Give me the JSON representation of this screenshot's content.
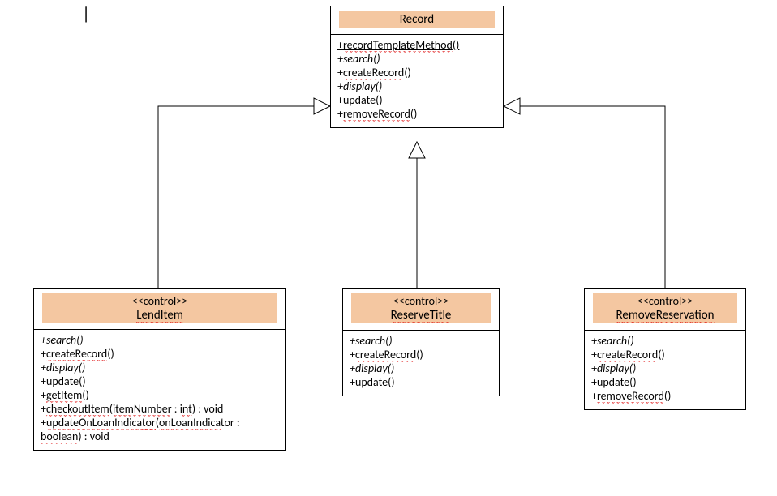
{
  "cursor": "|",
  "classes": {
    "record": {
      "name": "Record",
      "methods": [
        {
          "text": "+recordTemplateMethod()",
          "underline": true,
          "squiggle": "recordTemplateMethod"
        },
        {
          "text": "+search()",
          "italic": true
        },
        {
          "text": "+createRecord()",
          "squiggle": "createRecord"
        },
        {
          "text": "+display()",
          "italic": true
        },
        {
          "text": "+update()"
        },
        {
          "text": "+removeRecord()",
          "squiggle": "removeRecord"
        }
      ]
    },
    "lendItem": {
      "stereotype": "<<control>>",
      "name": "LendItem",
      "methods": [
        {
          "text": "+search()",
          "italic": true
        },
        {
          "text": "+createRecord()",
          "squiggle": "createRecord"
        },
        {
          "text": "+display()",
          "italic": true
        },
        {
          "text": "+update()"
        },
        {
          "text": "+getItem()",
          "squiggle": "getItem"
        },
        {
          "text": "+checkoutItem(itemNumber : int) : void",
          "squiggleParts": [
            "checkoutItem",
            "itemNumber",
            "int"
          ]
        },
        {
          "text": "+updateOnLoanIndicator(onLoanIndicator : boolean) : void",
          "wrap": true,
          "squiggleParts": [
            "updateOnLoanIndicator",
            "onLoanIndica",
            "tor",
            "boolean"
          ]
        }
      ]
    },
    "reserveTitle": {
      "stereotype": "<<control>>",
      "name": "ReserveTitle",
      "methods": [
        {
          "text": "+search()",
          "italic": true
        },
        {
          "text": "+createRecord()",
          "squiggle": "createRecord"
        },
        {
          "text": "+display()",
          "italic": true
        },
        {
          "text": "+update()"
        }
      ]
    },
    "removeReservation": {
      "stereotype": "<<control>>",
      "name": "RemoveReservation",
      "methods": [
        {
          "text": "+search()",
          "italic": true
        },
        {
          "text": "+createRecord()",
          "squiggle": "createRecord"
        },
        {
          "text": "+display()",
          "italic": true
        },
        {
          "text": "+update()"
        },
        {
          "text": "+removeRecord()",
          "squiggle": "removeRecord"
        }
      ]
    }
  }
}
